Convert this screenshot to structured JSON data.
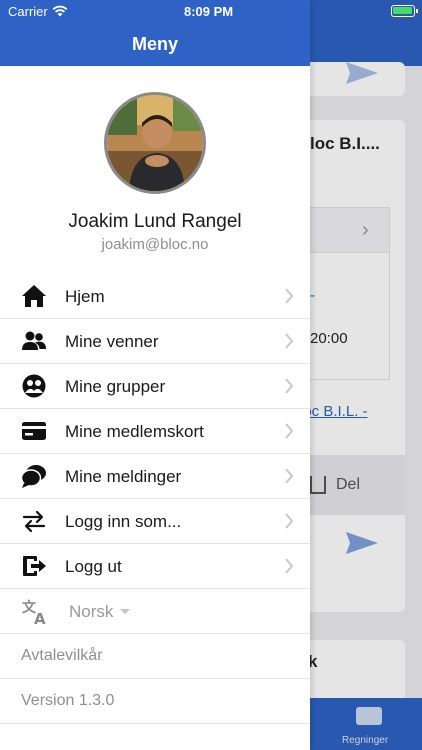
{
  "status_bar": {
    "carrier": "Carrier",
    "time": "8:09 PM"
  },
  "drawer": {
    "title": "Meny",
    "profile": {
      "name": "Joakim Lund Rangel",
      "email": "joakim@bloc.no"
    },
    "menu_items": [
      {
        "label": "Hjem",
        "icon": "home-icon"
      },
      {
        "label": "Mine venner",
        "icon": "friends-icon"
      },
      {
        "label": "Mine grupper",
        "icon": "groups-icon"
      },
      {
        "label": "Mine medlemskort",
        "icon": "membership-card-icon"
      },
      {
        "label": "Mine meldinger",
        "icon": "messages-icon"
      },
      {
        "label": "Logg inn som...",
        "icon": "switch-user-icon"
      },
      {
        "label": "Logg ut",
        "icon": "logout-icon"
      }
    ],
    "language": {
      "label": "Norsk",
      "icon": "translate-icon"
    },
    "terms_label": "Avtalevilkår",
    "version_label": "Version 1.3.0"
  },
  "background": {
    "card_title": "loc B.I....",
    "link_fragment": "-",
    "time_fragment": "20:00",
    "link_text": "loc B.I.L. -",
    "share_label": "Del",
    "bottom_card_fragment": "k",
    "tab_label": "Regninger"
  },
  "colors": {
    "brand_blue": "#2e63c5",
    "text_primary": "#1a1a1a",
    "text_secondary": "#8e8e93"
  }
}
